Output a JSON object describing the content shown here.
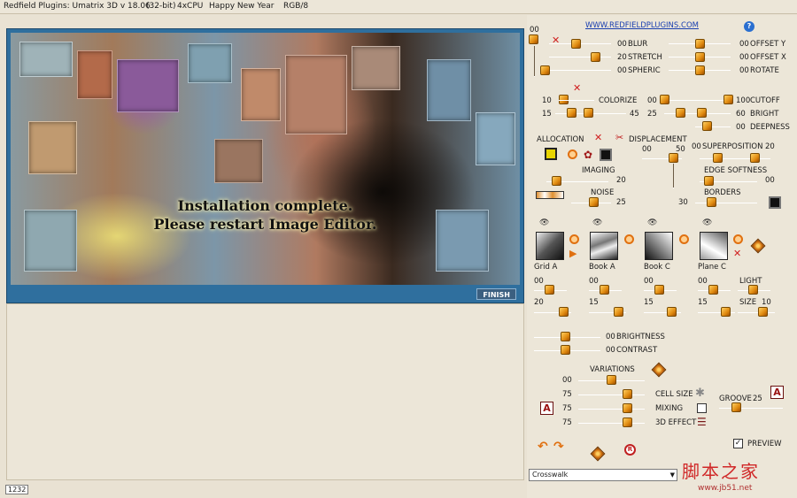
{
  "titlebar": {
    "app": "Redfield Plugins: Umatrix 3D v 18.06",
    "arch": "(32-bit)",
    "cpu": "4xCPU",
    "greeting": "Happy New Year",
    "mode": "RGB/8"
  },
  "preview": {
    "message_line1": "Installation complete.",
    "message_line2": "Please restart Image Editor.",
    "finish_label": "FINISH"
  },
  "status": {
    "value": "1232"
  },
  "panel": {
    "website": "WWW.REDFIELDPLUGINS.COM",
    "help": "?",
    "top_value": "00",
    "blur": {
      "value": "00",
      "label": "BLUR"
    },
    "stretch": {
      "value": "20",
      "label": "STRETCH"
    },
    "spheric": {
      "value": "00",
      "label": "SPHERIC"
    },
    "offset_y": {
      "value": "00",
      "label": "OFFSET Y"
    },
    "offset_x": {
      "value": "00",
      "label": "OFFSET X"
    },
    "rotate": {
      "value": "00",
      "label": "ROTATE"
    },
    "colorize": {
      "label": "COLORIZE",
      "v1": "10",
      "v2": "15",
      "v3": "45"
    },
    "cutoff": {
      "v1": "00",
      "v2": "100",
      "label": "CUTOFF"
    },
    "bright": {
      "v1": "25",
      "v2": "60",
      "label": "BRIGHT"
    },
    "deepness": {
      "value": "00",
      "label": "DEEPNESS"
    },
    "allocation": "ALLOCATION",
    "displacement": "DISPLACEMENT",
    "disp_v1": "00",
    "disp_v2": "50",
    "superposition": {
      "value": "00",
      "label": "SUPERPOSITION",
      "v2": "20"
    },
    "imaging": {
      "label": "IMAGING",
      "value": "20"
    },
    "edge_softness": {
      "label": "EDGE SOFTNESS",
      "value": "00"
    },
    "noise": {
      "label": "NOISE",
      "value": "25"
    },
    "borders": {
      "label": "BORDERS",
      "value": "30"
    },
    "shapes": [
      {
        "label": "Grid A"
      },
      {
        "label": "Book A"
      },
      {
        "label": "Book C"
      },
      {
        "label": "Plane C"
      }
    ],
    "shape_values_row1": [
      "00",
      "00",
      "00",
      "00"
    ],
    "shape_values_row2": [
      "20",
      "15",
      "15",
      "15"
    ],
    "light": {
      "label": "LIGHT"
    },
    "size": {
      "label": "SIZE",
      "value": "10"
    },
    "brightness": {
      "value": "00",
      "label": "BRIGHTNESS"
    },
    "contrast": {
      "value": "00",
      "label": "CONTRAST"
    },
    "variations": {
      "label": "VARIATIONS",
      "value": "00"
    },
    "var_values": [
      "75",
      "75",
      "75"
    ],
    "cell_size": "CELL SIZE",
    "mixing": "MIXING",
    "effect3d": "3D EFFECT",
    "groove": {
      "label": "GROOVE",
      "value": "25"
    },
    "preview_label": "PREVIEW",
    "a_button": "A",
    "reset_glyph": "R",
    "preset": "Crosswalk"
  },
  "watermark": {
    "cn": "脚本之家",
    "url": "www.jb51.net"
  },
  "colors": {
    "accent": "#e08a10",
    "frame": "#2f6f9e",
    "panel_bg": "#ece6d8",
    "link": "#1a3fb0",
    "red": "#d02020"
  }
}
